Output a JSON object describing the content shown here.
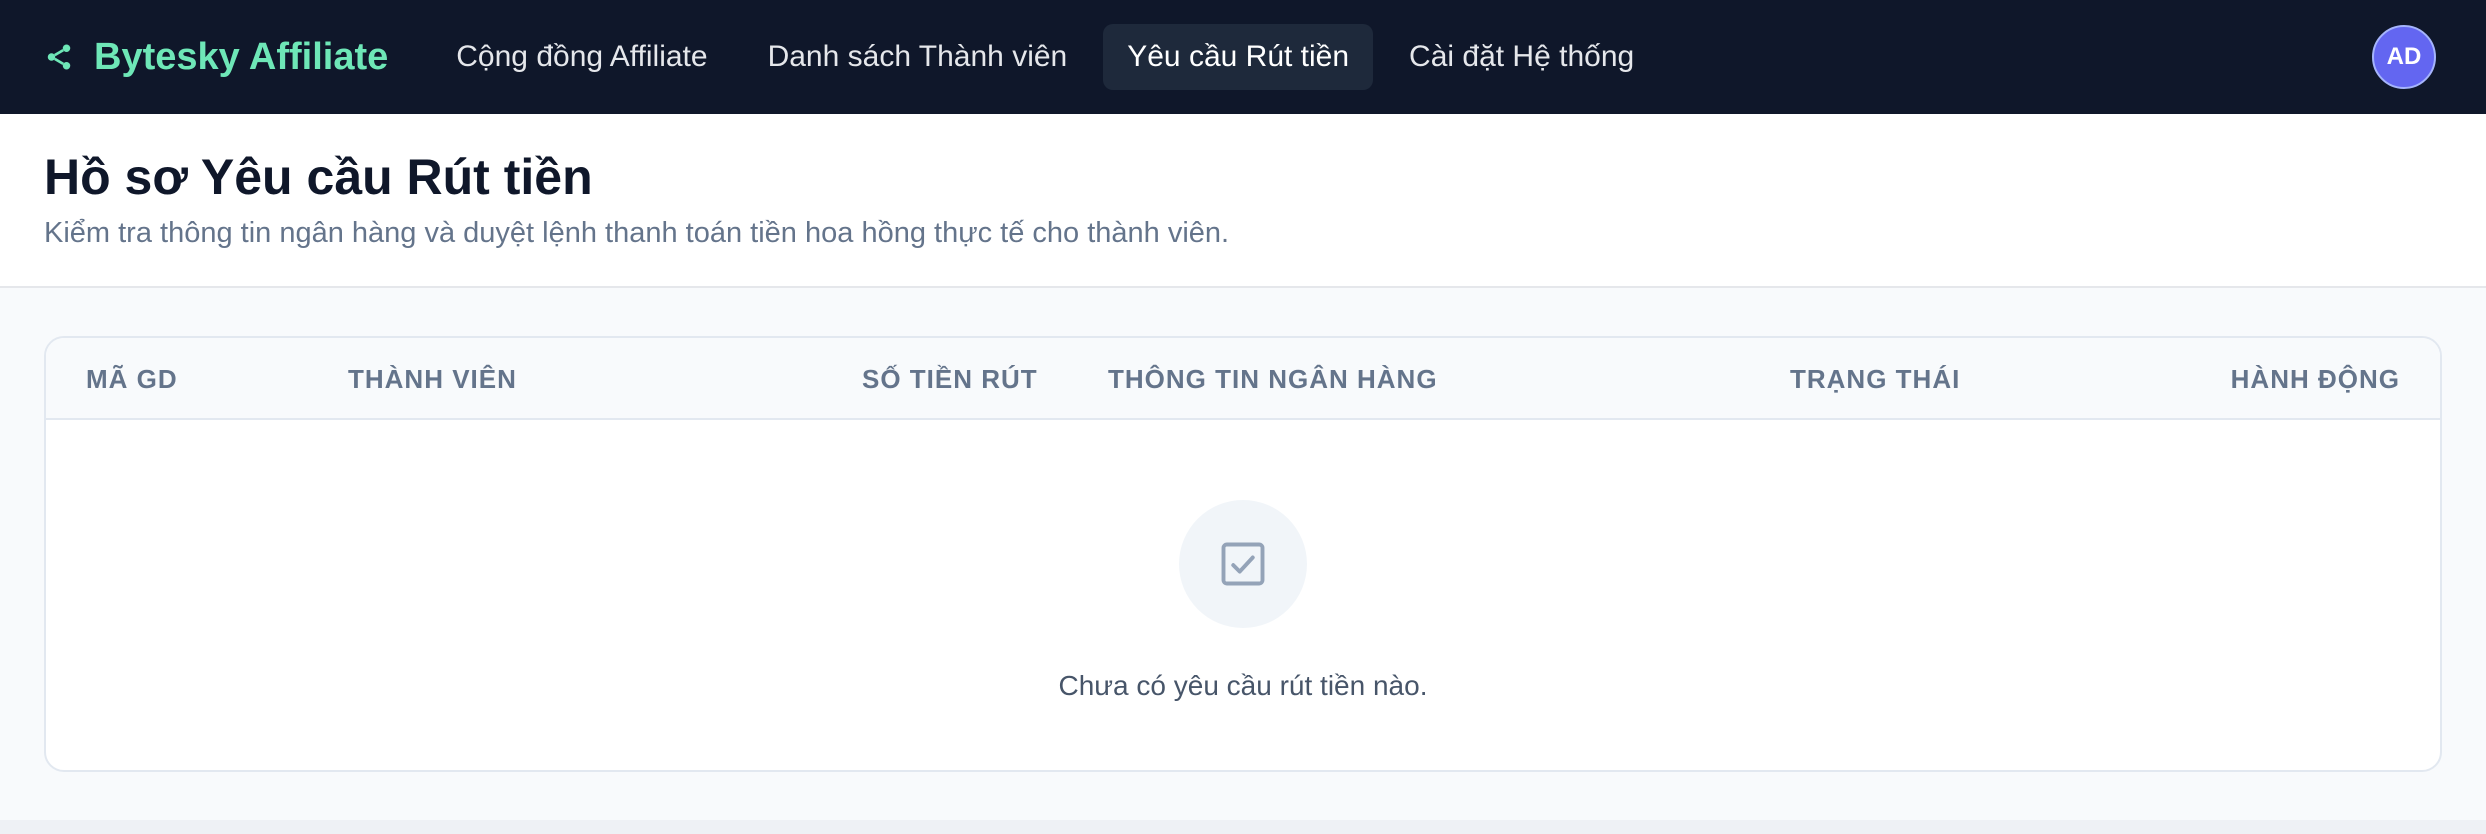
{
  "app": {
    "brand": "Bytesky Affiliate",
    "brand_icon": "share-icon",
    "brand_color": "#6ee7b7",
    "nav": [
      {
        "label": "Cộng đồng Affiliate",
        "active": false
      },
      {
        "label": "Danh sách Thành viên",
        "active": false
      },
      {
        "label": "Yêu cầu Rút tiền",
        "active": true
      },
      {
        "label": "Cài đặt Hệ thống",
        "active": false
      }
    ],
    "avatar_initials": "AD",
    "avatar_color": "#6366f1"
  },
  "page": {
    "title": "Hồ sơ Yêu cầu Rút tiền",
    "subtitle": "Kiểm tra thông tin ngân hàng và duyệt lệnh thanh toán tiền hoa hồng thực tế cho thành viên."
  },
  "table": {
    "columns": [
      "MÃ GD",
      "THÀNH VIÊN",
      "SỐ TIỀN RÚT",
      "THÔNG TIN NGÂN HÀNG",
      "TRẠNG THÁI",
      "HÀNH ĐỘNG"
    ],
    "rows": [],
    "empty_icon": "checkbox-check-icon",
    "empty_message": "Chưa có yêu cầu rút tiền nào."
  }
}
